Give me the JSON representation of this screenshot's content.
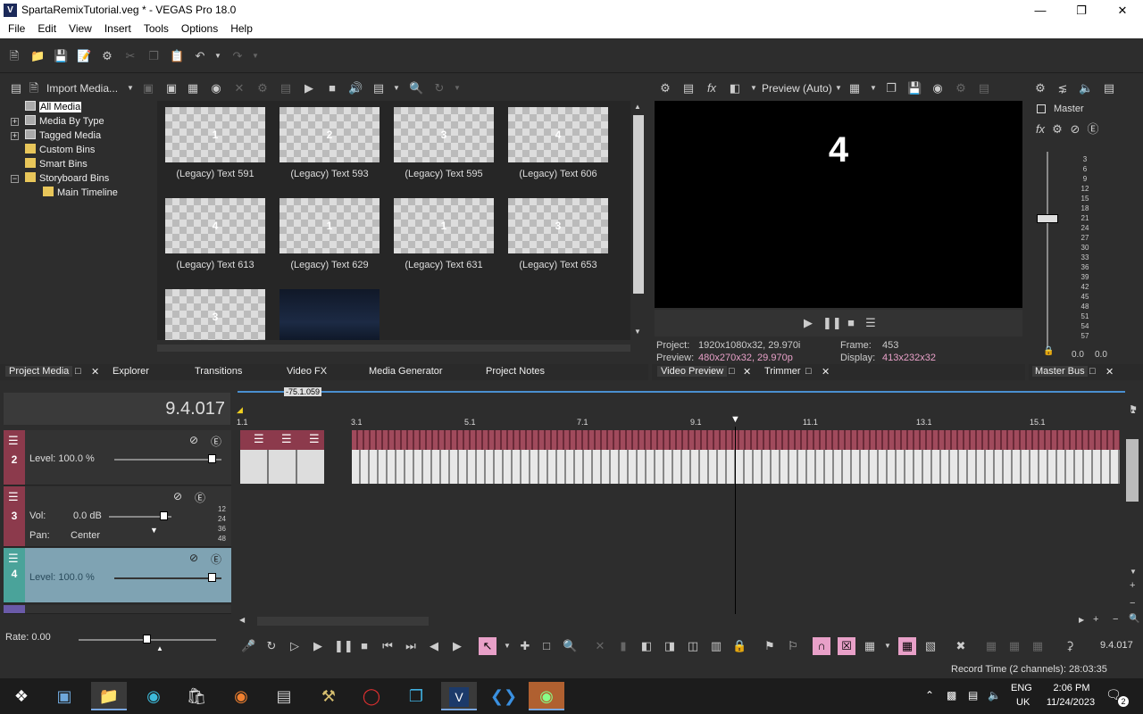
{
  "window": {
    "title": "SpartaRemixTutorial.veg * - VEGAS Pro 18.0",
    "app_icon": "V"
  },
  "menu": [
    "File",
    "Edit",
    "View",
    "Insert",
    "Tools",
    "Options",
    "Help"
  ],
  "media_toolbar": {
    "import_label": "Import Media..."
  },
  "tree": [
    {
      "label": "All Media"
    },
    {
      "label": "Media By Type"
    },
    {
      "label": "Tagged Media"
    },
    {
      "label": "Custom Bins"
    },
    {
      "label": "Smart Bins"
    },
    {
      "label": "Storyboard Bins"
    },
    {
      "label": "Main Timeline"
    }
  ],
  "media_items": [
    {
      "label": "(Legacy) Text 591",
      "glyph": "1"
    },
    {
      "label": "(Legacy) Text 593",
      "glyph": "2"
    },
    {
      "label": "(Legacy) Text 595",
      "glyph": "3"
    },
    {
      "label": "(Legacy) Text 606",
      "glyph": "4"
    },
    {
      "label": "(Legacy) Text 613",
      "glyph": "4"
    },
    {
      "label": "(Legacy) Text 629",
      "glyph": "1"
    },
    {
      "label": "(Legacy) Text 631",
      "glyph": "1"
    },
    {
      "label": "(Legacy) Text 653",
      "glyph": "3"
    },
    {
      "label": "",
      "glyph": "3"
    },
    {
      "label": "",
      "glyph": ""
    }
  ],
  "media_tabs": [
    "Project Media",
    "Explorer",
    "Transitions",
    "Video FX",
    "Media Generator",
    "Project Notes"
  ],
  "preview": {
    "mode": "Preview (Auto)",
    "frame_glyph": "4",
    "project_label": "Project:",
    "project_value": "1920x1080x32, 29.970i",
    "preview_label": "Preview:",
    "preview_value": "480x270x32, 29.970p",
    "frame_label": "Frame:",
    "frame_value": "453",
    "display_label": "Display:",
    "display_value": "413x232x32",
    "tabs": [
      "Video Preview",
      "Trimmer"
    ]
  },
  "master": {
    "label": "Master",
    "scale": [
      "3",
      "6",
      "9",
      "12",
      "15",
      "18",
      "21",
      "24",
      "27",
      "30",
      "33",
      "36",
      "39",
      "42",
      "45",
      "48",
      "51",
      "54",
      "57"
    ],
    "left_value": "0.0",
    "right_value": "0.0",
    "tab": "Master Bus"
  },
  "timeline": {
    "timecode": "9.4.017",
    "cursor_label": "-75.1.059",
    "ruler_marks": [
      "1.1",
      "3.1",
      "5.1",
      "7.1",
      "9.1",
      "11.1",
      "13.1",
      "15.1"
    ],
    "tracks": [
      {
        "number": "2",
        "level": "Level: 100.0 %"
      },
      {
        "number": "3",
        "vol_label": "Vol:",
        "vol_value": "0.0 dB",
        "pan_label": "Pan:",
        "pan_value": "Center",
        "meter": [
          "12",
          "24",
          "36",
          "48"
        ]
      },
      {
        "number": "4",
        "level": "Level: 100.0 %"
      }
    ],
    "rate": "Rate: 0.00",
    "end_timecode": "9.4.017"
  },
  "status": {
    "record_time": "Record Time (2 channels): 28:03:35"
  },
  "taskbar": {
    "lang": "ENG",
    "region": "UK",
    "time": "2:06 PM",
    "date": "11/24/2023",
    "notifications": "2"
  },
  "colors": {
    "accent_pink": "#e8a0c8",
    "track_red": "#8c3a4c",
    "track_teal": "#4aa39a"
  }
}
